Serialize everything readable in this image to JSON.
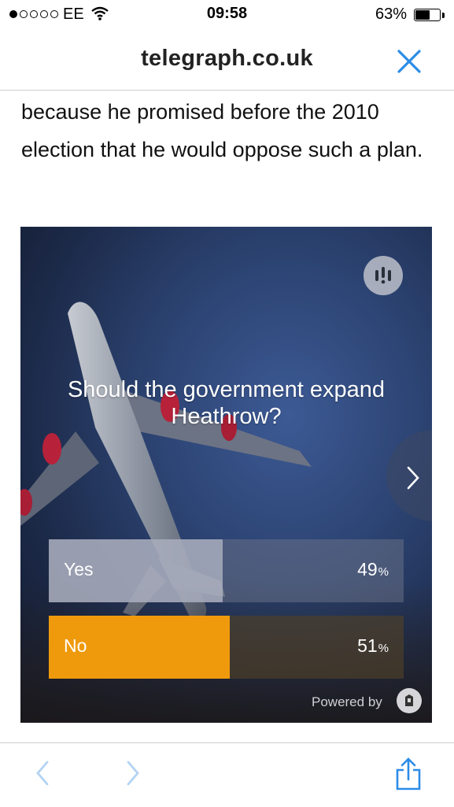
{
  "status_bar": {
    "carrier": "EE",
    "time": "09:58",
    "battery_percent_text": "63%",
    "battery_level": 0.63,
    "signal_bars_filled": 1,
    "signal_bars_total": 5
  },
  "browser": {
    "url": "telegraph.co.uk",
    "accent_color": "#2c8ce6"
  },
  "article": {
    "text": "because he promised before the 2010 election that he would oppose such a plan."
  },
  "poll": {
    "question": "Should the government expand Heathrow?",
    "options": [
      {
        "label": "Yes",
        "percent_value": "49",
        "percent_sign": "%",
        "share": 0.49
      },
      {
        "label": "No",
        "percent_value": "51",
        "percent_sign": "%",
        "share": 0.51,
        "color": "#ef9a0c"
      }
    ],
    "powered_by": "Powered by"
  },
  "icons": {
    "poll_logo": "opinion-stage-logo-icon",
    "next": "chevron-right-icon",
    "back": "chevron-left-icon",
    "forward": "chevron-right-icon",
    "share": "share-icon",
    "close": "close-icon"
  }
}
